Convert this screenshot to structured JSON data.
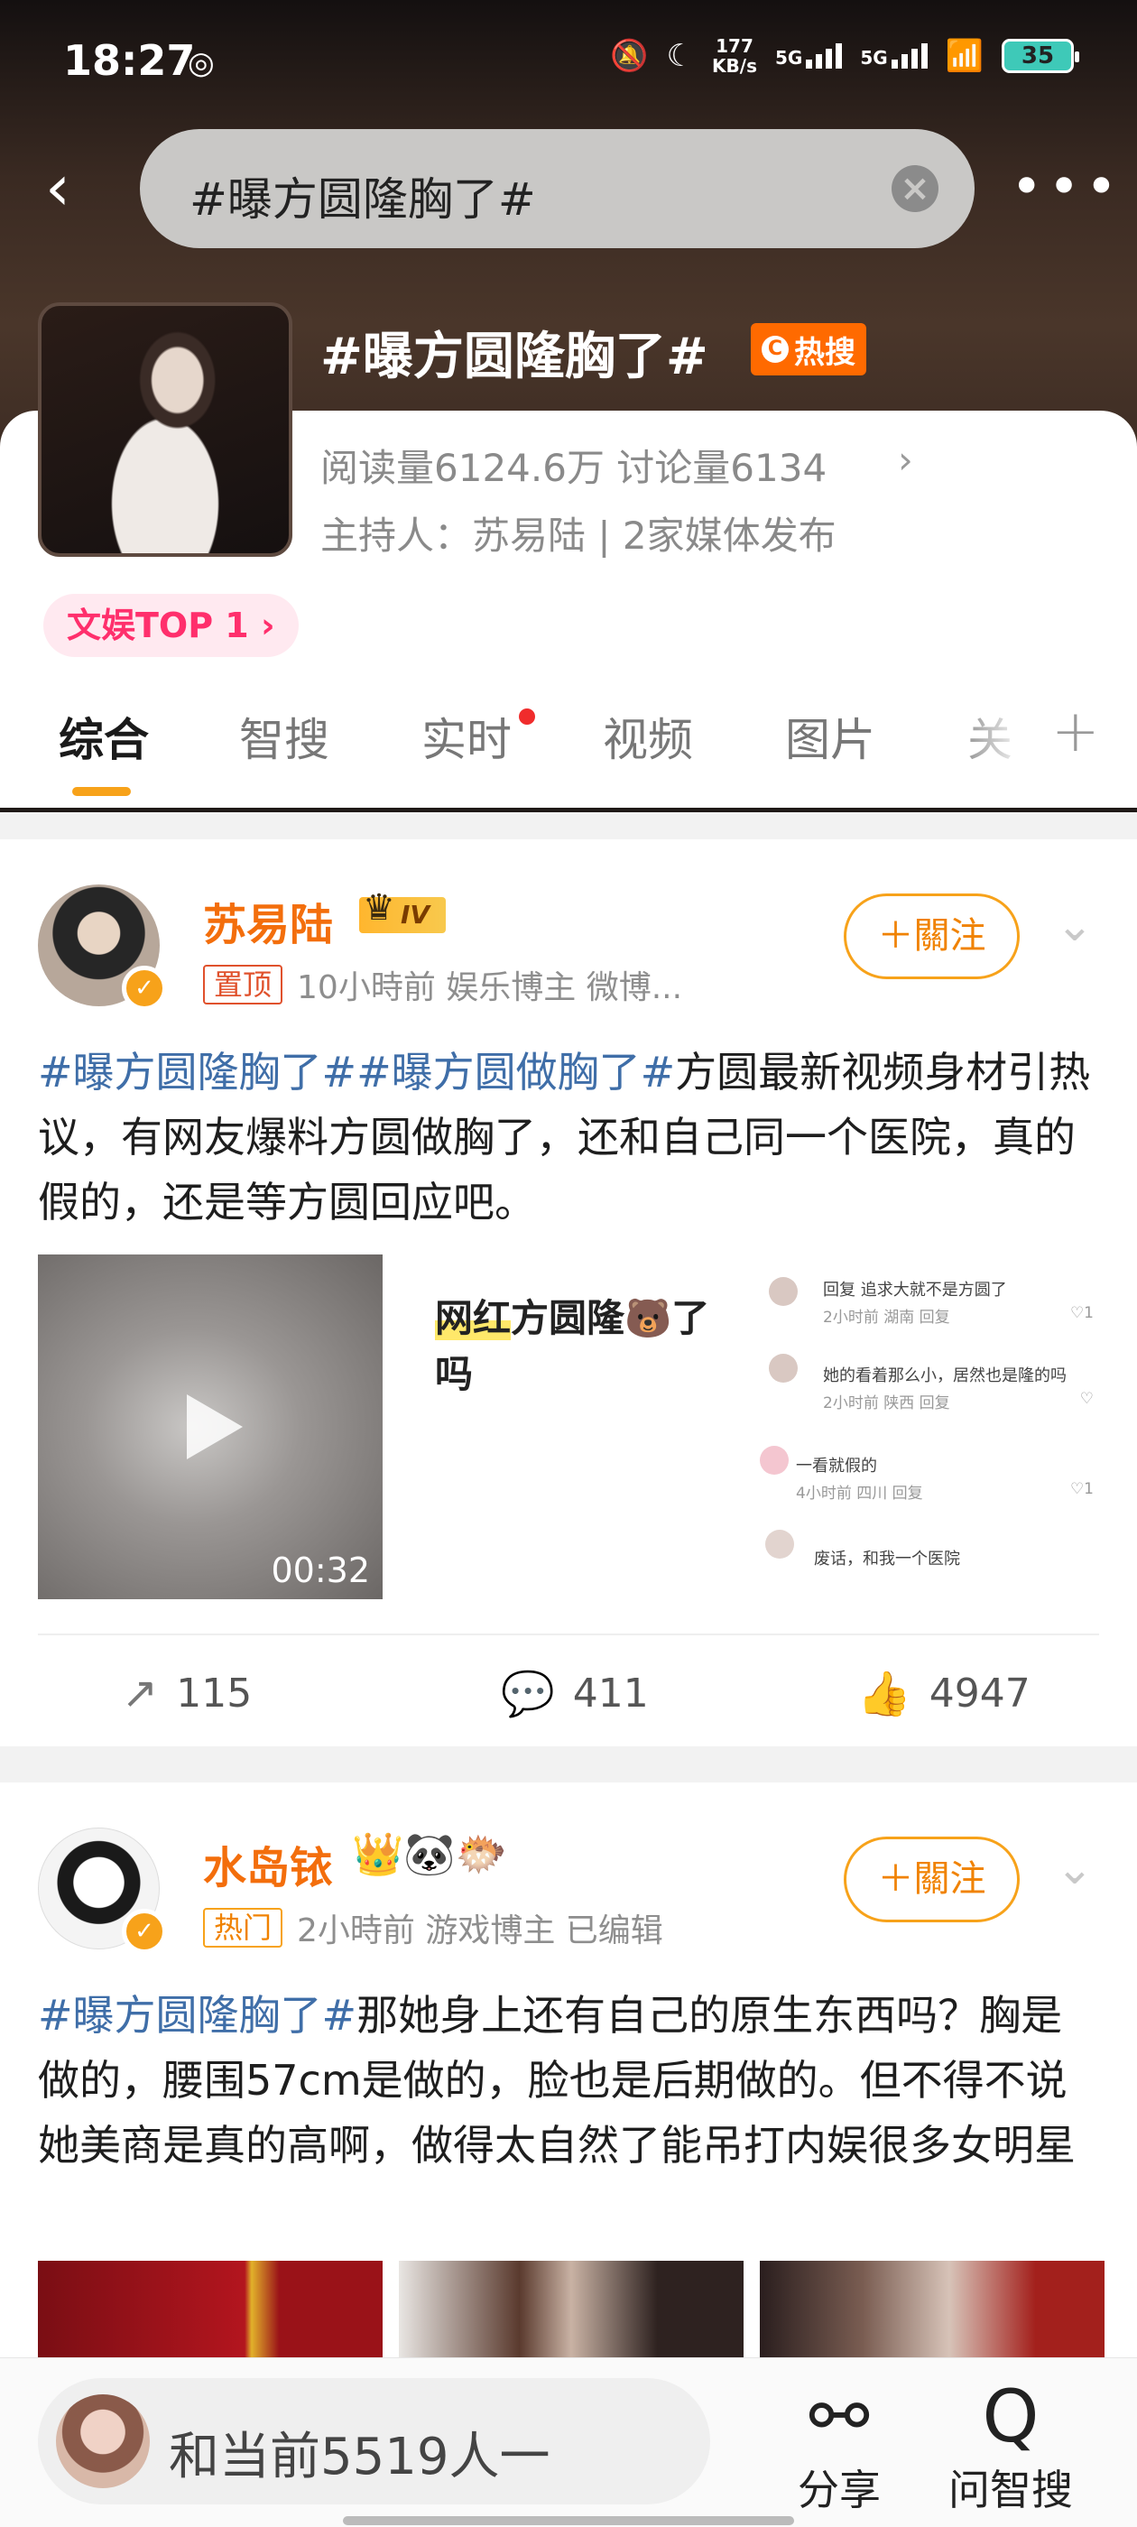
{
  "status": {
    "time": "18:27",
    "speed_value": "177",
    "speed_unit": "KB/s",
    "net1": "5G",
    "net2": "5G",
    "battery": "35"
  },
  "search": {
    "query": "#曝方圆隆胸了#"
  },
  "topic": {
    "title": "#曝方圆隆胸了#",
    "hot_label": "热搜",
    "stats": "阅读量6124.6万  讨论量6134",
    "host_line": "主持人：苏易陆 | 2家媒体发布",
    "rank": "文娱TOP 1 ›"
  },
  "tabs": [
    {
      "label": "综合"
    },
    {
      "label": "智搜"
    },
    {
      "label": "实时"
    },
    {
      "label": "视频"
    },
    {
      "label": "图片"
    },
    {
      "label": "关"
    }
  ],
  "posts": [
    {
      "user": "苏易陆",
      "level": "IV",
      "tag": "置顶",
      "meta": "10小時前   娱乐博主 微博...",
      "follow": "＋關注",
      "text_hashtags": "#曝方圆隆胸了##曝方圆做胸了#",
      "text_body": "方圆最新视频身材引热议，有网友爆料方圆做胸了，还和自己同一个医院，真的假的，还是等方圆回应吧。",
      "video_duration": "00:32",
      "image2_text_hl": "网红",
      "image2_text": "方圆隆🐻了吗",
      "comments": [
        {
          "main": "回复        追求大就不是方圆了",
          "sub": "2小时前 湖南  回复",
          "like": "♡1"
        },
        {
          "main": "她的看着那么小，居然也是隆的吗",
          "sub": "2小时前 陕西  回复",
          "like": "♡"
        },
        {
          "main": "一看就假的",
          "sub": "4小时前 四川  回复",
          "like": "♡1"
        },
        {
          "main": "废话，和我一个医院",
          "sub": "",
          "like": ""
        }
      ],
      "reposts": "115",
      "comments_count": "411",
      "likes": "4947"
    },
    {
      "user": "水岛铱",
      "tag": "热门",
      "meta": "2小時前   游戏博主   已编辑",
      "follow": "＋關注",
      "text_hashtags": "#曝方圆隆胸了#",
      "text_body": "那她身上还有自己的原生东西吗？胸是做的，腰围57cm是做的，脸也是后期做的。但不得不说她美商是真的高啊，做得太自然了能吊打内娱很多女明星"
    }
  ],
  "bottom": {
    "live_text": "和当前5519人一",
    "share": "分享",
    "ask": "问智搜"
  },
  "colors": {
    "accent": "#f7a21a",
    "hashtag": "#3f6ea8",
    "username": "#f36e0c",
    "hot": "#ff6a00",
    "rank": "#ff2f6c"
  }
}
